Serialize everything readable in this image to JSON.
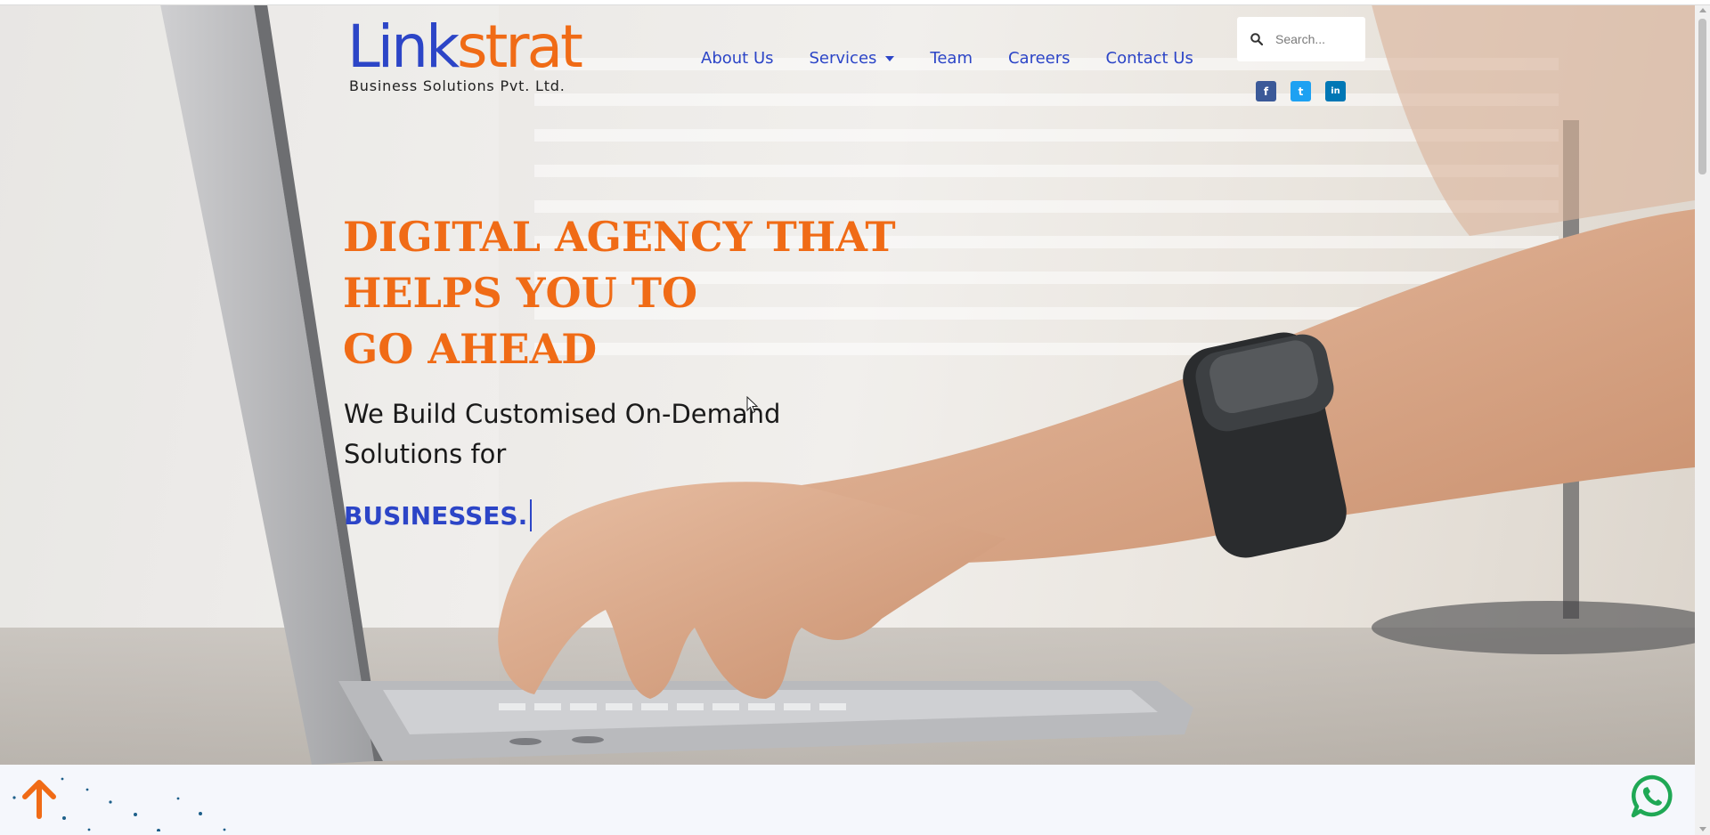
{
  "brand": {
    "logo_primary": "Link",
    "logo_accent": "strat",
    "logo_subtitle": "Business Solutions Pvt. Ltd.",
    "color_primary": "#2c45c7",
    "color_accent": "#f06b16"
  },
  "nav": {
    "items": [
      {
        "label": "About Us"
      },
      {
        "label": "Services",
        "has_dropdown": true
      },
      {
        "label": "Team"
      },
      {
        "label": "Careers"
      },
      {
        "label": "Contact Us"
      }
    ]
  },
  "search": {
    "placeholder": "Search...",
    "icon": "search-icon"
  },
  "social": [
    {
      "name": "facebook-icon",
      "glyph": "f",
      "color": "#3b5998"
    },
    {
      "name": "twitter-icon",
      "glyph": "t",
      "color": "#1da1f2"
    },
    {
      "name": "linkedin-icon",
      "glyph": "in",
      "color": "#0077b5"
    }
  ],
  "hero": {
    "headline_lines": [
      "DIGITAL AGENCY THAT",
      "HELPS YOU TO",
      "GO AHEAD"
    ],
    "subheadline": "We Build Customised On-Demand Solutions for",
    "typed_word": "BUSINESSES."
  },
  "floating": {
    "back_to_top": "arrow-up-icon",
    "chat": "whatsapp-icon"
  }
}
